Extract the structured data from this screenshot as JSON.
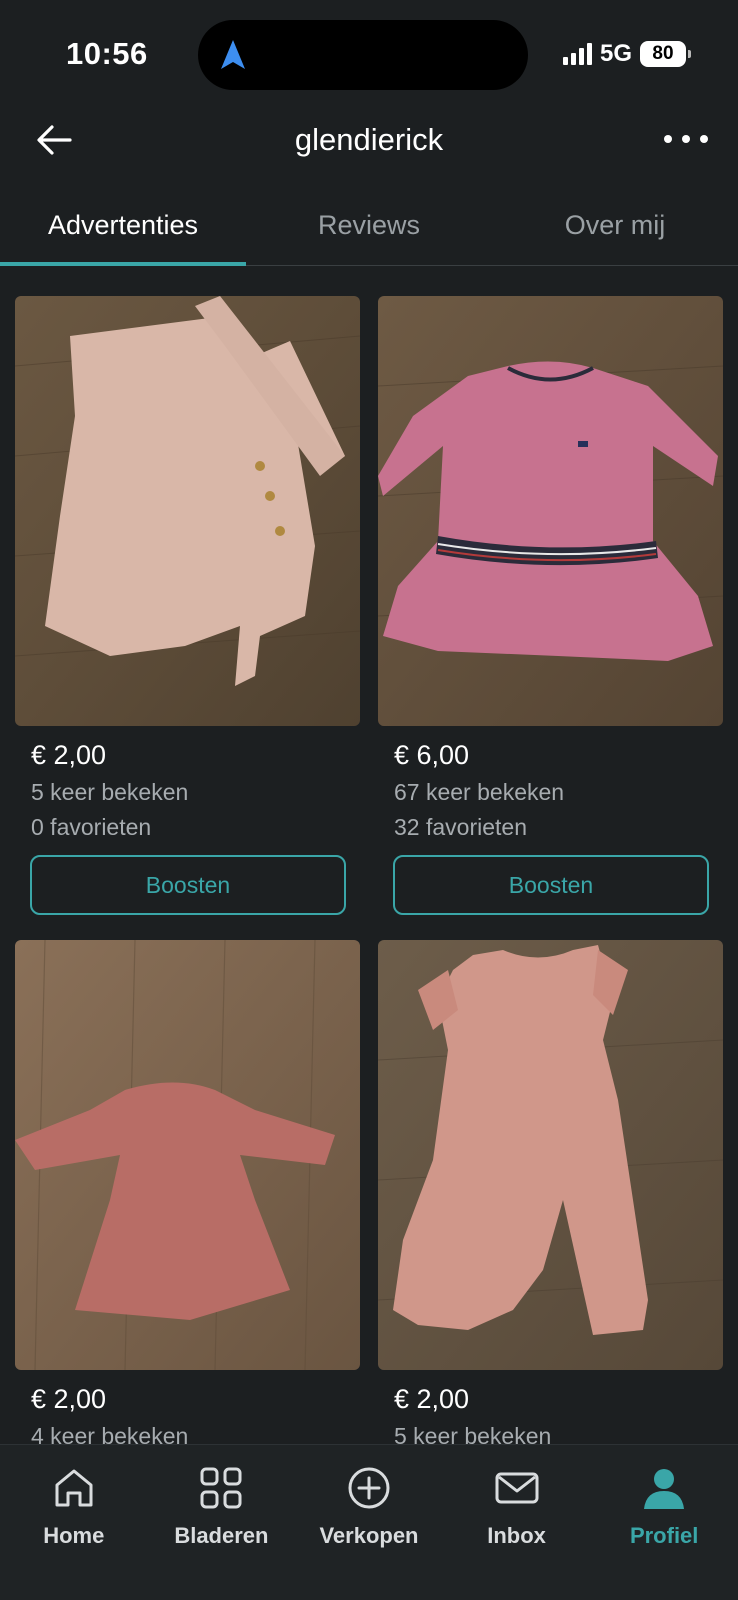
{
  "status_bar": {
    "time": "10:56",
    "network": "5G",
    "battery": "80"
  },
  "header": {
    "title": "glendierick"
  },
  "tabs": [
    {
      "label": "Advertenties",
      "active": true
    },
    {
      "label": "Reviews",
      "active": false
    },
    {
      "label": "Over mij",
      "active": false
    }
  ],
  "listings": [
    {
      "price": "€ 2,00",
      "views": "5 keer bekeken",
      "favorites": "0 favorieten",
      "button": "Boosten",
      "item": "light pink knitted baby dress"
    },
    {
      "price": "€ 6,00",
      "views": "67 keer bekeken",
      "favorites": "32 favorieten",
      "button": "Boosten",
      "item": "pink velvet dress with striped waistband"
    },
    {
      "price": "€ 2,00",
      "views": "4 keer bekeken",
      "item": "dusty rose knitted dress"
    },
    {
      "price": "€ 2,00",
      "views": "5 keer bekeken",
      "item": "pink muslin jumpsuit"
    }
  ],
  "bottom_nav": [
    {
      "label": "Home",
      "icon": "home-icon"
    },
    {
      "label": "Bladeren",
      "icon": "grid-icon"
    },
    {
      "label": "Verkopen",
      "icon": "plus-circle-icon"
    },
    {
      "label": "Inbox",
      "icon": "mail-icon"
    },
    {
      "label": "Profiel",
      "icon": "profile-icon",
      "active": true
    }
  ],
  "colors": {
    "accent": "#3aa6a8",
    "background": "#1c1f21"
  }
}
